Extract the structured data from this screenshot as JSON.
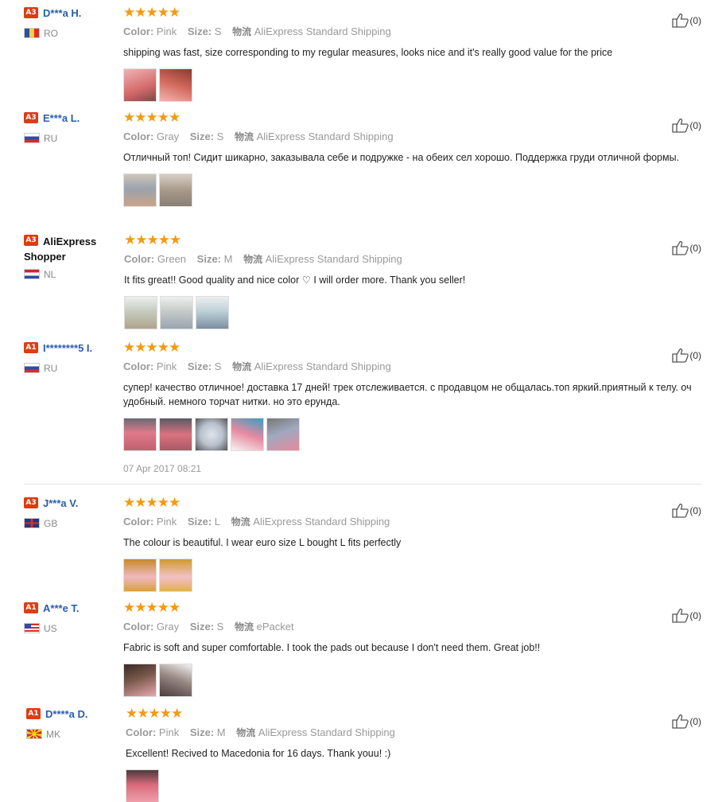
{
  "reviews": [
    {
      "level": "A3",
      "name": "D***a H.",
      "country": "RO",
      "flag": "ro",
      "rating": 5,
      "stars": "★★★★★",
      "meta": {
        "color_label": "Color:",
        "color": "Pink",
        "size_label": "Size:",
        "size": "S",
        "logistics_label": "物流",
        "shipping": "AliExpress Standard Shipping"
      },
      "text": "shipping was fast, size corresponding to my regular measures, looks nice and it's really good value for the price",
      "photos": 2,
      "photo_palette": [
        "#e8a6a6",
        "#d46a5e"
      ],
      "useful": "(0)"
    },
    {
      "level": "A3",
      "name": "E***a L.",
      "country": "RU",
      "flag": "ru",
      "rating": 5,
      "stars": "★★★★★",
      "meta": {
        "color_label": "Color:",
        "color": "Gray",
        "size_label": "Size:",
        "size": "S",
        "logistics_label": "物流",
        "shipping": "AliExpress Standard Shipping"
      },
      "text": "Отличный топ! Сидит шикарно, заказывала себе и подружке - на обеих сел хорошо. Поддержка груди отличной формы.",
      "photos": 2,
      "photo_palette": [
        "#b9aa9a",
        "#a8998a"
      ],
      "useful": "(0)"
    },
    {
      "level": "A3",
      "name": "AliExpress Shopper",
      "country": "NL",
      "flag": "nl",
      "rating": 5,
      "stars": "★★★★★",
      "meta": {
        "color_label": "Color:",
        "color": "Green",
        "size_label": "Size:",
        "size": "M",
        "logistics_label": "物流",
        "shipping": "AliExpress Standard Shipping"
      },
      "text": "It fits great!! Good quality and nice color ♡ I will order more. Thank you seller!",
      "photos": 3,
      "photo_palette": [
        "#c8d0c4",
        "#c9cfcb",
        "#bcd1d8"
      ],
      "useful": "(0)"
    },
    {
      "level": "A1",
      "name": "I********5 I.",
      "country": "RU",
      "flag": "ru",
      "rating": 5,
      "stars": "★★★★★",
      "meta": {
        "color_label": "Color:",
        "color": "Pink",
        "size_label": "Size:",
        "size": "S",
        "logistics_label": "物流",
        "shipping": "AliExpress Standard Shipping"
      },
      "text": "супер! качество отличное! доставка 17 дней! трек отслеживается. с продавцом не общалась.топ яркий.приятный к телу. оч удобный. немного торчат нитки. но это ерунда.",
      "photos": 5,
      "photo_palette": [
        "#e07a8a",
        "#d9737f",
        "#b7c0cc",
        "#e88aa0",
        "#a0a8c0"
      ],
      "date": "07 Apr 2017 08:21",
      "useful": "(0)"
    },
    {
      "level": "A3",
      "name": "J***a V.",
      "country": "GB",
      "flag": "gb",
      "rating": 5,
      "stars": "★★★★★",
      "meta": {
        "color_label": "Color:",
        "color": "Pink",
        "size_label": "Size:",
        "size": "L",
        "logistics_label": "物流",
        "shipping": "AliExpress Standard Shipping"
      },
      "text": "The colour is beautiful. I wear euro size L bought L fits perfectly",
      "photos": 2,
      "photo_palette": [
        "#d9a13a",
        "#e2b14a"
      ],
      "useful": "(0)"
    },
    {
      "level": "A1",
      "name": "A***e T.",
      "country": "US",
      "flag": "us",
      "rating": 5,
      "stars": "★★★★★",
      "meta": {
        "color_label": "Color:",
        "color": "Gray",
        "size_label": "Size:",
        "size": "S",
        "logistics_label": "物流",
        "shipping": "ePacket"
      },
      "text": "Fabric is soft and super comfortable. I took the pads out because I don't need them. Great job!!",
      "photos": 2,
      "photo_palette": [
        "#7a5a4c",
        "#9a8a84"
      ],
      "useful": "(0)"
    },
    {
      "level": "A1",
      "name": "D****a D.",
      "country": "MK",
      "flag": "mk",
      "rating": 5,
      "stars": "★★★★★",
      "meta": {
        "color_label": "Color:",
        "color": "Pink",
        "size_label": "Size:",
        "size": "M",
        "logistics_label": "物流",
        "shipping": "AliExpress Standard Shipping"
      },
      "text": "Excellent! Recived to Macedonia for 16 days. Thank youu! :)",
      "photos": 1,
      "photo_palette": [
        "#d86a7a"
      ],
      "useful": "(0)"
    }
  ],
  "colors": {
    "link": "#2a5db0",
    "star": "#f29a12",
    "badge": "#e03d11",
    "muted": "#999999"
  },
  "icons": {
    "useful": "thumbs-up-icon",
    "rating": "star-icon"
  }
}
